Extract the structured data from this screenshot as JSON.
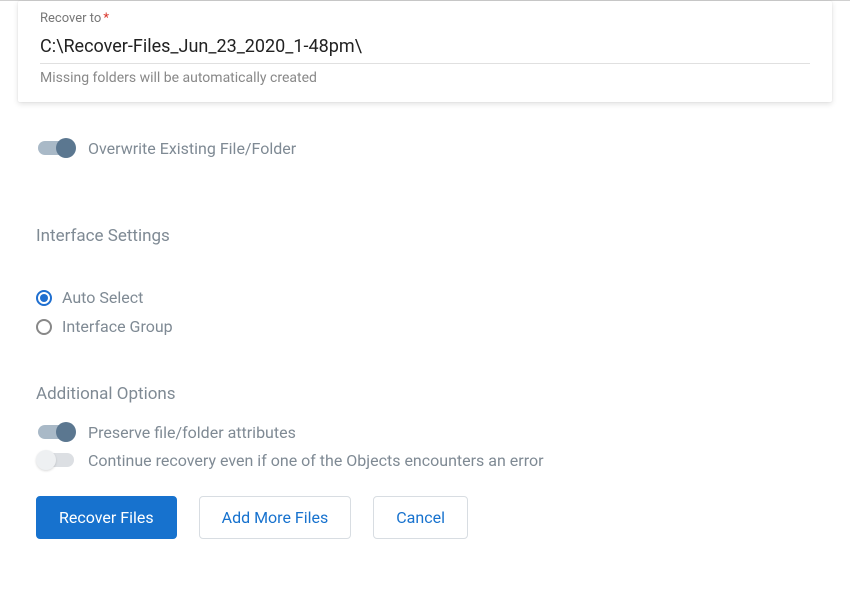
{
  "recover": {
    "label": "Recover to",
    "required_marker": "*",
    "value": "C:\\Recover-Files_Jun_23_2020_1-48pm\\",
    "hint": "Missing folders will be automatically created"
  },
  "overwrite": {
    "label": "Overwrite Existing File/Folder",
    "on": true
  },
  "interface": {
    "title": "Interface Settings",
    "options": {
      "auto": "Auto Select",
      "group": "Interface Group"
    },
    "selected": "auto"
  },
  "additional": {
    "title": "Additional Options",
    "preserve": {
      "label": "Preserve file/folder attributes",
      "on": true
    },
    "continue_on_error": {
      "label": "Continue recovery even if one of the Objects encounters an error",
      "on": false
    }
  },
  "buttons": {
    "recover": "Recover Files",
    "add_more": "Add More Files",
    "cancel": "Cancel"
  }
}
